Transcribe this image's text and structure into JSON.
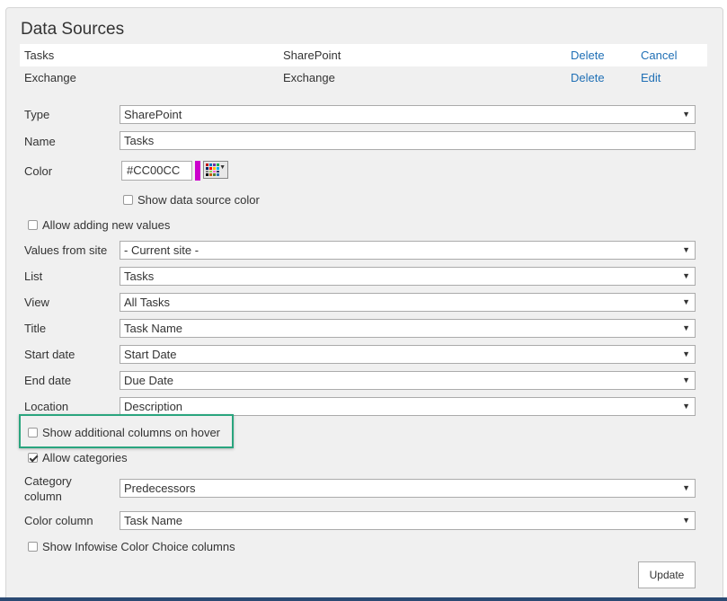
{
  "title": "Data Sources",
  "data_sources": [
    {
      "name": "Tasks",
      "type": "SharePoint",
      "delete_label": "Delete",
      "action_label": "Cancel"
    },
    {
      "name": "Exchange",
      "type": "Exchange",
      "delete_label": "Delete",
      "action_label": "Edit"
    }
  ],
  "form": {
    "type": {
      "label": "Type",
      "value": "SharePoint"
    },
    "name": {
      "label": "Name",
      "value": "Tasks"
    },
    "color": {
      "label": "Color",
      "value": "#CC00CC",
      "swatch_color": "#CC00CC",
      "picker_icon": "color-palette-icon"
    },
    "show_color": {
      "label": "Show data source color",
      "checked": false
    },
    "allow_new_values": {
      "label": "Allow adding new values",
      "checked": false
    },
    "values_from_site": {
      "label": "Values from site",
      "value": "- Current site -"
    },
    "list": {
      "label": "List",
      "value": "Tasks"
    },
    "view": {
      "label": "View",
      "value": "All Tasks"
    },
    "title_field": {
      "label": "Title",
      "value": "Task Name"
    },
    "start_date": {
      "label": "Start date",
      "value": "Start Date"
    },
    "end_date": {
      "label": "End date",
      "value": "Due Date"
    },
    "location": {
      "label": "Location",
      "value": "Description"
    },
    "show_additional": {
      "label": "Show additional columns on hover",
      "checked": false
    },
    "allow_categories": {
      "label": "Allow categories",
      "checked": true
    },
    "category_column": {
      "label_line1": "Category",
      "label_line2": "column",
      "value": "Predecessors"
    },
    "color_column": {
      "label": "Color column",
      "value": "Task Name"
    },
    "show_infowise": {
      "label": "Show Infowise Color Choice columns",
      "checked": false
    }
  },
  "update_label": "Update",
  "colors": {
    "link": "#1f6fb5",
    "highlight_border": "#2aa57e",
    "panel_bg": "#f0f0f0",
    "bottom_strip": "#2b4a73"
  }
}
